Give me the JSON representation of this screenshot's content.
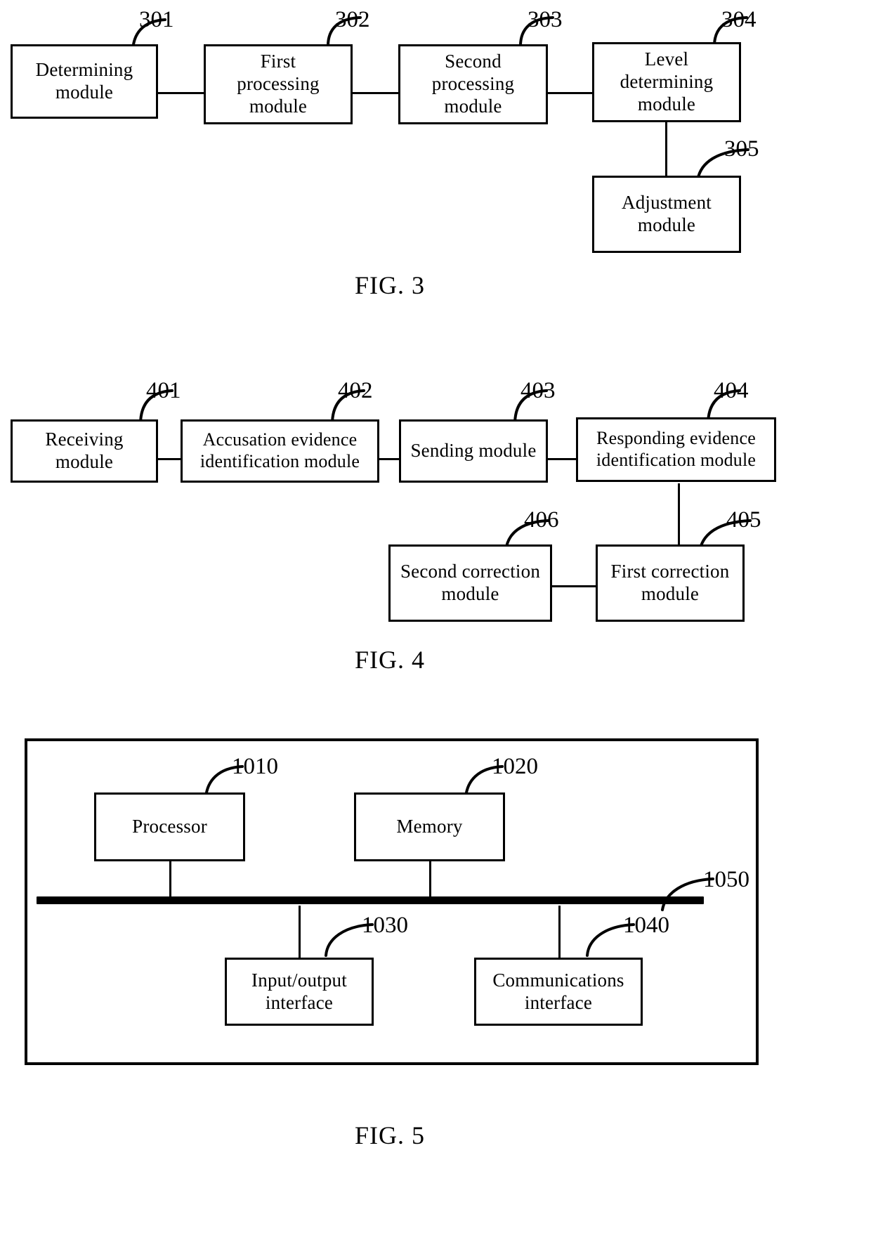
{
  "document": {
    "type": "patent-drawing-sheet",
    "figures": [
      {
        "id": "fig3",
        "label": "FIG. 3",
        "blocks": [
          {
            "ref": "301",
            "lines": [
              "Determining",
              "module"
            ]
          },
          {
            "ref": "302",
            "lines": [
              "First",
              "processing",
              "module"
            ]
          },
          {
            "ref": "303",
            "lines": [
              "Second",
              "processing",
              "module"
            ]
          },
          {
            "ref": "304",
            "lines": [
              "Level",
              "determining",
              "module"
            ]
          },
          {
            "ref": "305",
            "lines": [
              "Adjustment",
              "module"
            ]
          }
        ]
      },
      {
        "id": "fig4",
        "label": "FIG. 4",
        "blocks": [
          {
            "ref": "401",
            "lines": [
              "Receiving",
              "module"
            ]
          },
          {
            "ref": "402",
            "lines": [
              "Accusation evidence",
              "identification module"
            ]
          },
          {
            "ref": "403",
            "lines": [
              "Sending module"
            ]
          },
          {
            "ref": "404",
            "lines": [
              "Responding evidence",
              "identification module"
            ]
          },
          {
            "ref": "405",
            "lines": [
              "First correction",
              "module"
            ]
          },
          {
            "ref": "406",
            "lines": [
              "Second correction",
              "module"
            ]
          }
        ]
      },
      {
        "id": "fig5",
        "label": "FIG. 5",
        "blocks": [
          {
            "ref": "1010",
            "lines": [
              "Processor"
            ]
          },
          {
            "ref": "1020",
            "lines": [
              "Memory"
            ]
          },
          {
            "ref": "1030",
            "lines": [
              "Input/output",
              "interface"
            ]
          },
          {
            "ref": "1040",
            "lines": [
              "Communications",
              "interface"
            ]
          },
          {
            "ref": "1050",
            "lines": []
          }
        ]
      }
    ]
  },
  "fig3": {
    "label": "FIG. 3",
    "b301": {
      "ref": "301",
      "l1": "Determining",
      "l2": "module"
    },
    "b302": {
      "ref": "302",
      "l1": "First",
      "l2": "processing",
      "l3": "module"
    },
    "b303": {
      "ref": "303",
      "l1": "Second",
      "l2": "processing",
      "l3": "module"
    },
    "b304": {
      "ref": "304",
      "l1": "Level",
      "l2": "determining",
      "l3": "module"
    },
    "b305": {
      "ref": "305",
      "l1": "Adjustment",
      "l2": "module"
    }
  },
  "fig4": {
    "label": "FIG. 4",
    "b401": {
      "ref": "401",
      "l1": "Receiving",
      "l2": "module"
    },
    "b402": {
      "ref": "402",
      "l1": "Accusation evidence",
      "l2": "identification module"
    },
    "b403": {
      "ref": "403",
      "l1": "Sending module"
    },
    "b404": {
      "ref": "404",
      "l1": "Responding evidence",
      "l2": "identification module"
    },
    "b405": {
      "ref": "405",
      "l1": "First correction",
      "l2": "module"
    },
    "b406": {
      "ref": "406",
      "l1": "Second correction",
      "l2": "module"
    }
  },
  "fig5": {
    "label": "FIG. 5",
    "b1010": {
      "ref": "1010",
      "l1": "Processor"
    },
    "b1020": {
      "ref": "1020",
      "l1": "Memory"
    },
    "b1030": {
      "ref": "1030",
      "l1": "Input/output",
      "l2": "interface"
    },
    "b1040": {
      "ref": "1040",
      "l1": "Communications",
      "l2": "interface"
    },
    "bus": {
      "ref": "1050"
    }
  },
  "colors": {
    "ink": "#000000",
    "paper": "#ffffff"
  }
}
